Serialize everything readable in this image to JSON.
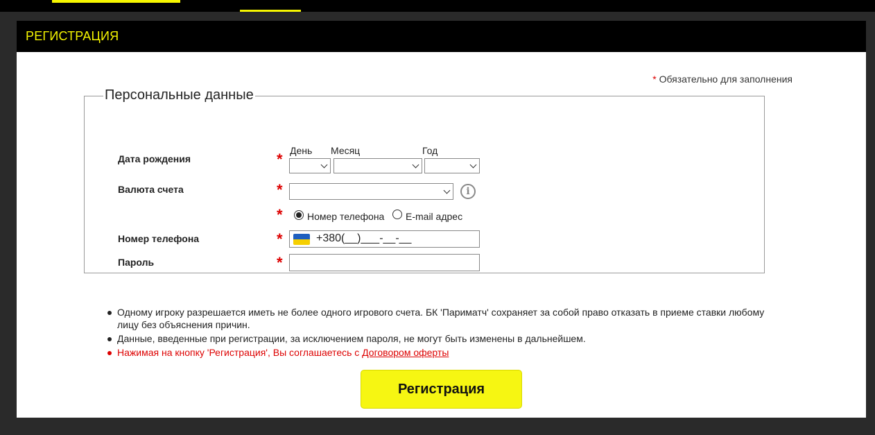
{
  "header": {
    "title": "РЕГИСТРАЦИЯ"
  },
  "required_note": {
    "star": "*",
    "text": " Обязательно для заполнения"
  },
  "fieldset": {
    "legend": "Персональные данные"
  },
  "fields": {
    "birthdate": {
      "label": "Дата рождения",
      "day_label": "День",
      "month_label": "Месяц",
      "year_label": "Год",
      "day_value": "",
      "month_value": "",
      "year_value": ""
    },
    "currency": {
      "label": "Валюта счета",
      "value": "",
      "info_icon": "i"
    },
    "contact_type": {
      "options": [
        "Номер телефона",
        "E-mail адрес"
      ],
      "selected": "Номер телефона"
    },
    "phone": {
      "label": "Номер телефона",
      "flag": "ukraine-flag",
      "mask": "+380(__)___-__-__"
    },
    "password": {
      "label": "Пароль",
      "value": ""
    },
    "required_star": "*"
  },
  "notes": [
    "Одному игроку разрешается иметь не более одного игрового счета. БК 'Париматч' сохраняет за собой право отказать в приеме ставки любому лицу без объяснения причин.",
    "Данные, введенные при регистрации, за исключением пароля, не могут быть изменены в дальнейшем.",
    "Нажимая на кнопку 'Регистрация', Вы соглашаетесь с "
  ],
  "offer_link": "Договором оферты",
  "submit_button": "Регистрация",
  "colors": {
    "accent": "#f6f600",
    "header_bg": "#000000",
    "required": "#dd0000"
  }
}
